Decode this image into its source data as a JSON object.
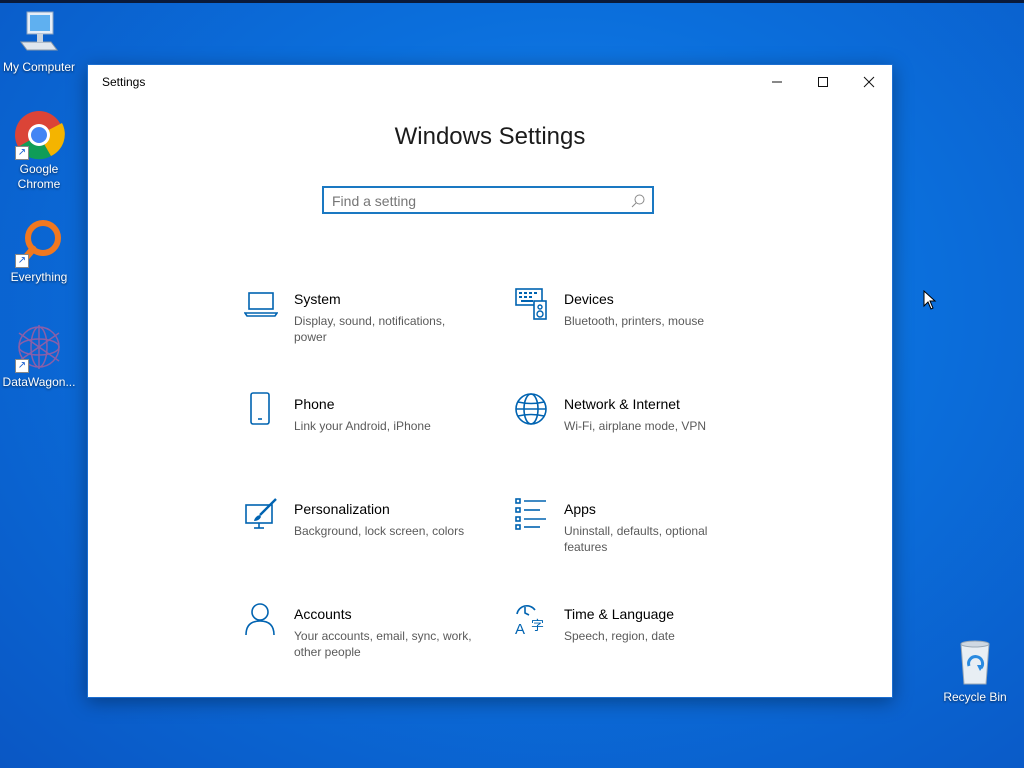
{
  "desktop": {
    "icons": [
      {
        "label": "My Computer",
        "icon": "computer-icon"
      },
      {
        "label": "Google Chrome",
        "icon": "chrome-icon"
      },
      {
        "label": "Everything",
        "icon": "everything-search-icon"
      },
      {
        "label": "DataWagon...",
        "icon": "datawagon-icon"
      },
      {
        "label": "Recycle Bin",
        "icon": "recycle-bin-icon"
      }
    ],
    "background_color": "#0b6fdc"
  },
  "window": {
    "title": "Settings",
    "controls": {
      "minimize": "minimize-icon",
      "maximize": "maximize-icon",
      "close": "close-icon"
    }
  },
  "settings": {
    "heading": "Windows Settings",
    "search": {
      "placeholder": "Find a setting",
      "value": ""
    },
    "accent_color": "#0063b1",
    "categories": [
      {
        "name": "System",
        "description": "Display, sound, notifications, power",
        "icon": "laptop-icon"
      },
      {
        "name": "Devices",
        "description": "Bluetooth, printers, mouse",
        "icon": "devices-icon"
      },
      {
        "name": "Phone",
        "description": "Link your Android, iPhone",
        "icon": "phone-icon"
      },
      {
        "name": "Network & Internet",
        "description": "Wi-Fi, airplane mode, VPN",
        "icon": "globe-icon"
      },
      {
        "name": "Personalization",
        "description": "Background, lock screen, colors",
        "icon": "paint-brush-icon"
      },
      {
        "name": "Apps",
        "description": "Uninstall, defaults, optional features",
        "icon": "apps-list-icon"
      },
      {
        "name": "Accounts",
        "description": "Your accounts, email, sync, work, other people",
        "icon": "person-icon"
      },
      {
        "name": "Time & Language",
        "description": "Speech, region, date",
        "icon": "time-language-icon"
      }
    ]
  }
}
